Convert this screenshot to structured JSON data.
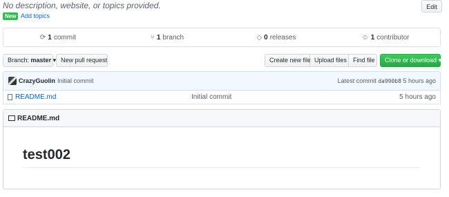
{
  "repo": {
    "description": "No description, website, or topics provided.",
    "edit_label": "Edit",
    "new_badge": "New",
    "add_topics": "Add topics"
  },
  "summary": {
    "commits": {
      "count": "1",
      "label": "commit"
    },
    "branches": {
      "count": "1",
      "label": "branch"
    },
    "releases": {
      "count": "0",
      "label": "releases"
    },
    "contributors": {
      "count": "1",
      "label": "contributor"
    }
  },
  "toolbar": {
    "branch_prefix": "Branch:",
    "branch_name": "master",
    "new_pr": "New pull request",
    "create_file": "Create new file",
    "upload_files": "Upload files",
    "find_file": "Find file",
    "clone": "Clone or download"
  },
  "commit": {
    "author": "CrazyGuolin",
    "message": "Initial commit",
    "latest_label": "Latest commit",
    "sha": "da990b8",
    "age": "5 hours ago"
  },
  "files": [
    {
      "name": "README.md",
      "commit": "Initial commit",
      "age": "5 hours ago"
    }
  ],
  "readme": {
    "filename": "README.md",
    "heading": "test002"
  },
  "colors": {
    "accent": "#0366d6",
    "clone_button": "#28a745",
    "new_badge": "#2cbe4e"
  }
}
